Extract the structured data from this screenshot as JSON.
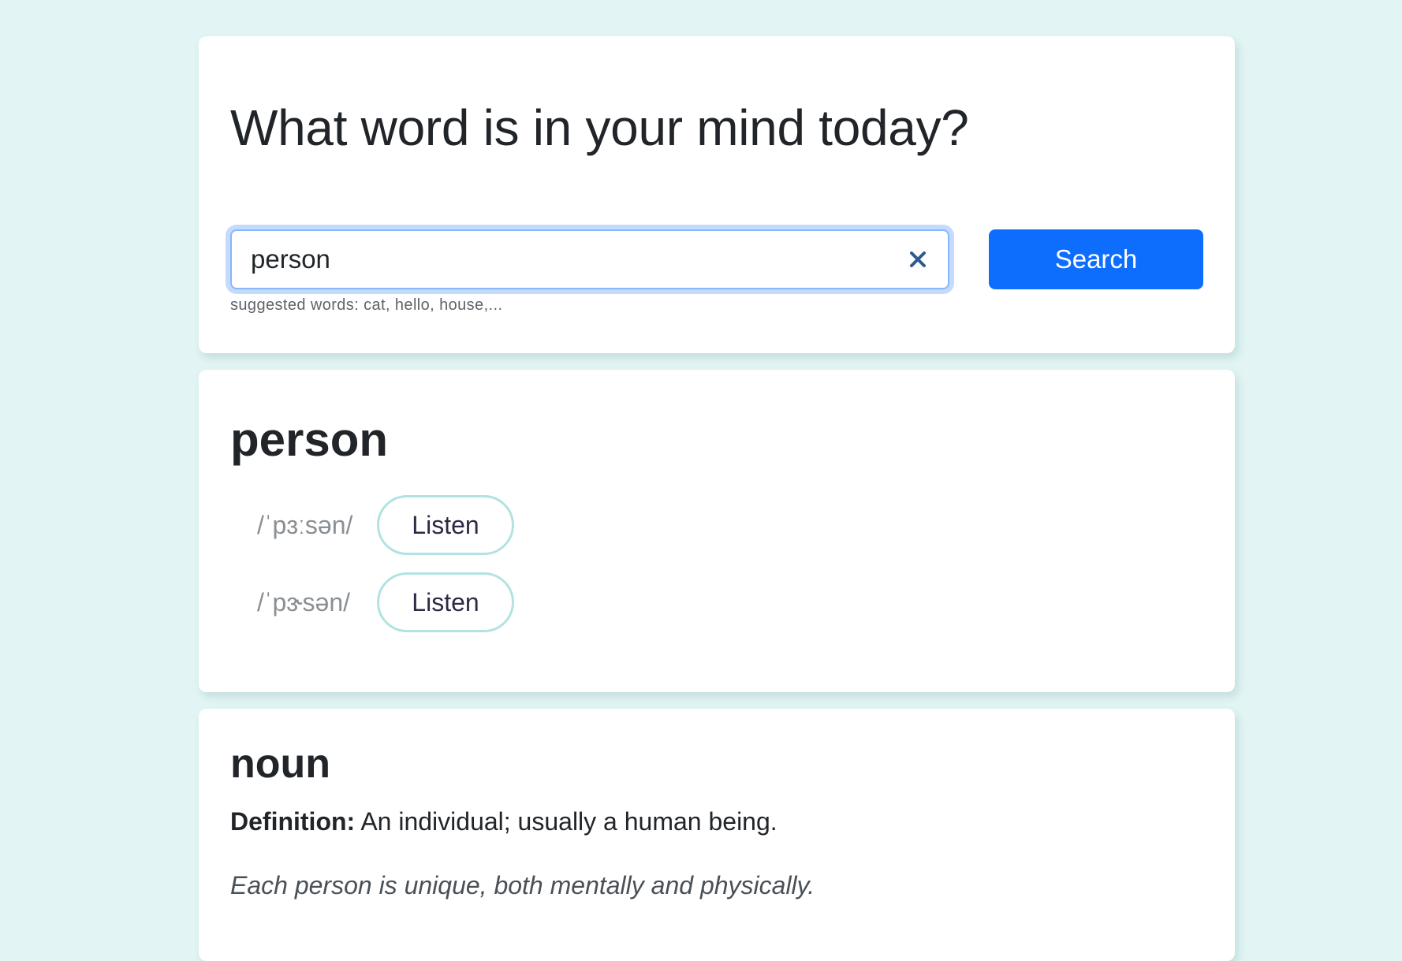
{
  "search": {
    "title": "What word is in your mind today?",
    "input_value": "person",
    "hint": "suggested words: cat, hello, house,...",
    "button_label": "Search"
  },
  "word": {
    "headword": "person",
    "phonetics": [
      {
        "text": "/ˈpɜːsən/",
        "listen_label": "Listen"
      },
      {
        "text": "/ˈpɝsən/",
        "listen_label": "Listen"
      }
    ]
  },
  "meaning": {
    "part_of_speech": "noun",
    "definition_label": "Definition:",
    "definition": "An individual; usually a human being.",
    "example": "Each person is unique, both mentally and physically."
  },
  "colors": {
    "background": "#e2f4f4",
    "primary": "#0d6efd",
    "listen_border": "#b2e2e2",
    "clear_icon": "#2f5a8f"
  },
  "icons": {
    "clear": "close-icon"
  }
}
